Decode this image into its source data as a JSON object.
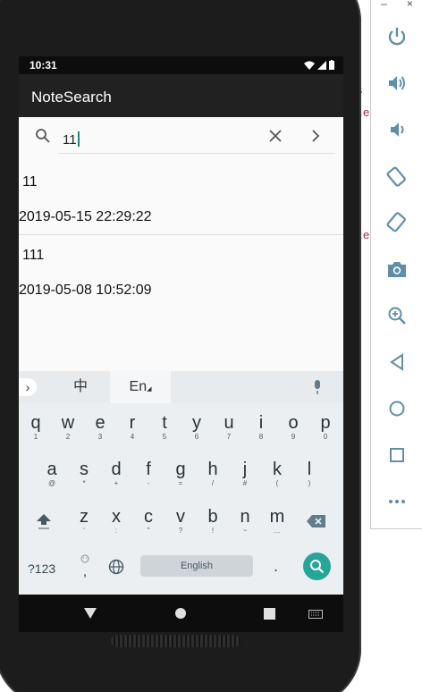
{
  "status_bar": {
    "time": "10:31"
  },
  "app_bar": {
    "title": "NoteSearch"
  },
  "search": {
    "value": "11"
  },
  "notes": [
    {
      "title": "11",
      "date": "2019-05-15 22:29:22"
    },
    {
      "title": "111",
      "date": "2019-05-08 10:52:09"
    }
  ],
  "keyboard": {
    "lang_chinese": "中",
    "lang_english": "En",
    "row1": [
      {
        "key": "q",
        "hint": "1"
      },
      {
        "key": "w",
        "hint": "2"
      },
      {
        "key": "e",
        "hint": "3"
      },
      {
        "key": "r",
        "hint": "4"
      },
      {
        "key": "t",
        "hint": "5"
      },
      {
        "key": "y",
        "hint": "6"
      },
      {
        "key": "u",
        "hint": "7"
      },
      {
        "key": "i",
        "hint": "8"
      },
      {
        "key": "o",
        "hint": "9"
      },
      {
        "key": "p",
        "hint": "0"
      }
    ],
    "row2": [
      {
        "key": "a",
        "hint": "@"
      },
      {
        "key": "s",
        "hint": "*"
      },
      {
        "key": "d",
        "hint": "+"
      },
      {
        "key": "f",
        "hint": "-"
      },
      {
        "key": "g",
        "hint": "="
      },
      {
        "key": "h",
        "hint": "/"
      },
      {
        "key": "j",
        "hint": "#"
      },
      {
        "key": "k",
        "hint": "("
      },
      {
        "key": "l",
        "hint": ")"
      }
    ],
    "row3": [
      {
        "key": "z",
        "hint": "'"
      },
      {
        "key": "x",
        "hint": ":"
      },
      {
        "key": "c",
        "hint": "\""
      },
      {
        "key": "v",
        "hint": "?"
      },
      {
        "key": "b",
        "hint": "!"
      },
      {
        "key": "n",
        "hint": "~"
      },
      {
        "key": "m",
        "hint": "..."
      }
    ],
    "symbols_label": "?123",
    "comma": ",",
    "space_label": "English",
    "period": "."
  },
  "ide_fragment": [
    "s",
    "te",
    "te"
  ],
  "icons": {
    "search": "search-icon",
    "clear": "close-icon",
    "go": "chevron-right-icon",
    "mic": "mic-icon",
    "globe": "globe-icon",
    "shift": "shift-icon",
    "backspace": "backspace-icon",
    "emoji": "emoji-icon",
    "enter": "search-icon"
  },
  "emulator_panel": {
    "buttons": [
      "power-icon",
      "volume-up-icon",
      "volume-down-icon",
      "rotate-left-icon",
      "rotate-right-icon",
      "camera-icon",
      "zoom-icon",
      "back-icon",
      "home-icon",
      "overview-icon",
      "more-icon"
    ]
  },
  "colors": {
    "accent": "#26a69a",
    "app_bar": "#212121",
    "status_bar": "#0d0d0d",
    "panel_icon": "#5f8fa8"
  }
}
